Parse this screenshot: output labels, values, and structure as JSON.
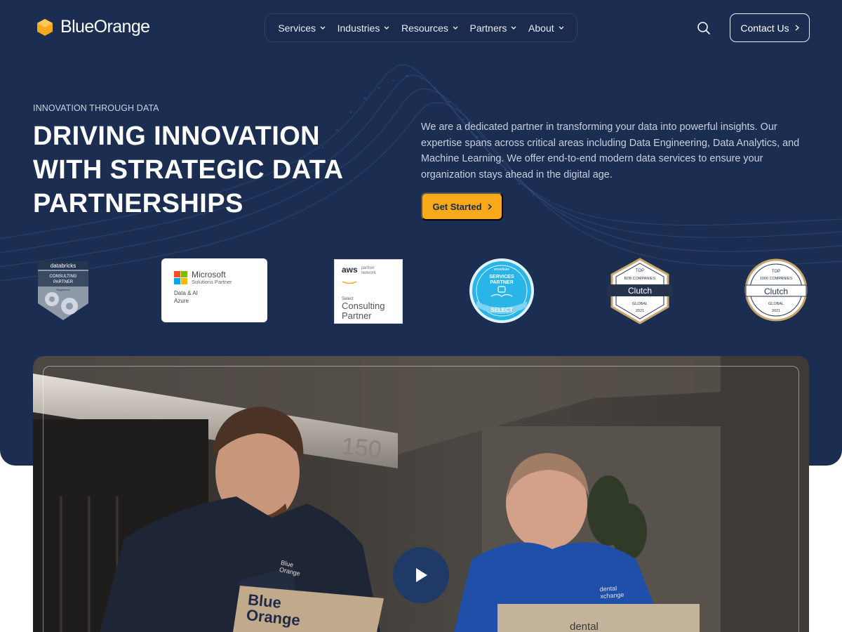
{
  "brand": {
    "name": "BlueOrange",
    "color_navy": "#1b2e52",
    "color_orange": "#f7a81b"
  },
  "nav": {
    "items": [
      {
        "label": "Services"
      },
      {
        "label": "Industries"
      },
      {
        "label": "Resources"
      },
      {
        "label": "Partners"
      },
      {
        "label": "About"
      }
    ],
    "search_icon": "search-icon",
    "contact_label": "Contact Us"
  },
  "hero": {
    "eyebrow": "INNOVATION THROUGH DATA",
    "headline_lines": [
      "DRIVING INNOVATION",
      "WITH STRATEGIC DATA",
      "PARTNERSHIPS"
    ],
    "description": "We are a dedicated partner in transforming your data into powerful insights. Our expertise spans across critical areas including Data Engineering, Data Analytics, and Machine Learning. We offer end-to-end modern data services to ensure your organization stays ahead in the digital age.",
    "cta_label": "Get Started"
  },
  "badges": {
    "databricks": {
      "brand": "databricks",
      "line1": "CONSULTING",
      "line2": "PARTNER",
      "line3": "Registered"
    },
    "microsoft": {
      "name": "Microsoft",
      "sub": "Solutions Partner",
      "line1": "Data & AI",
      "line2": "Azure"
    },
    "aws": {
      "logo": "aws",
      "network1": "partner",
      "network2": "network",
      "select": "Select",
      "tier1": "Consulting",
      "tier2": "Partner"
    },
    "snowflake": {
      "brand": "snowflake",
      "line1": "SERVICES",
      "line2": "PARTNER",
      "line3": "SELECT"
    },
    "clutch_b2b": {
      "top": "TOP",
      "category": "B2B COMPANIES",
      "brand": "Clutch",
      "region": "GLOBAL",
      "year": "2021"
    },
    "clutch_1000": {
      "top": "TOP",
      "category": "1000 COMPANIES",
      "brand": "Clutch",
      "region": "GLOBAL",
      "year": "2021"
    }
  },
  "video": {
    "play_icon": "play-icon",
    "wall_number": "150",
    "laptop_left": [
      "Blue",
      "Orange"
    ],
    "shirt_left": [
      "Blue",
      "Orange"
    ],
    "shirt_right": [
      "dental",
      "xchange"
    ],
    "laptop_right": "dental"
  }
}
